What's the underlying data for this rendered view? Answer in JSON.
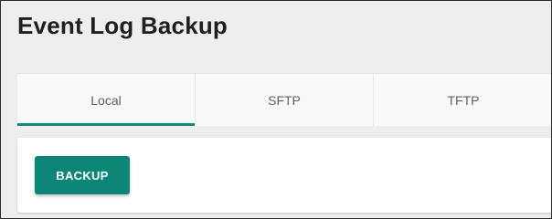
{
  "header": {
    "title": "Event Log Backup"
  },
  "tabs": [
    {
      "label": "Local",
      "active": true
    },
    {
      "label": "SFTP",
      "active": false
    },
    {
      "label": "TFTP",
      "active": false
    }
  ],
  "actions": {
    "backup_label": "BACKUP"
  },
  "colors": {
    "accent": "#16877b",
    "button": "#0e8677",
    "background": "#eeeeee",
    "title": "#1f1f1f",
    "tab_text": "#5f5f5f"
  }
}
